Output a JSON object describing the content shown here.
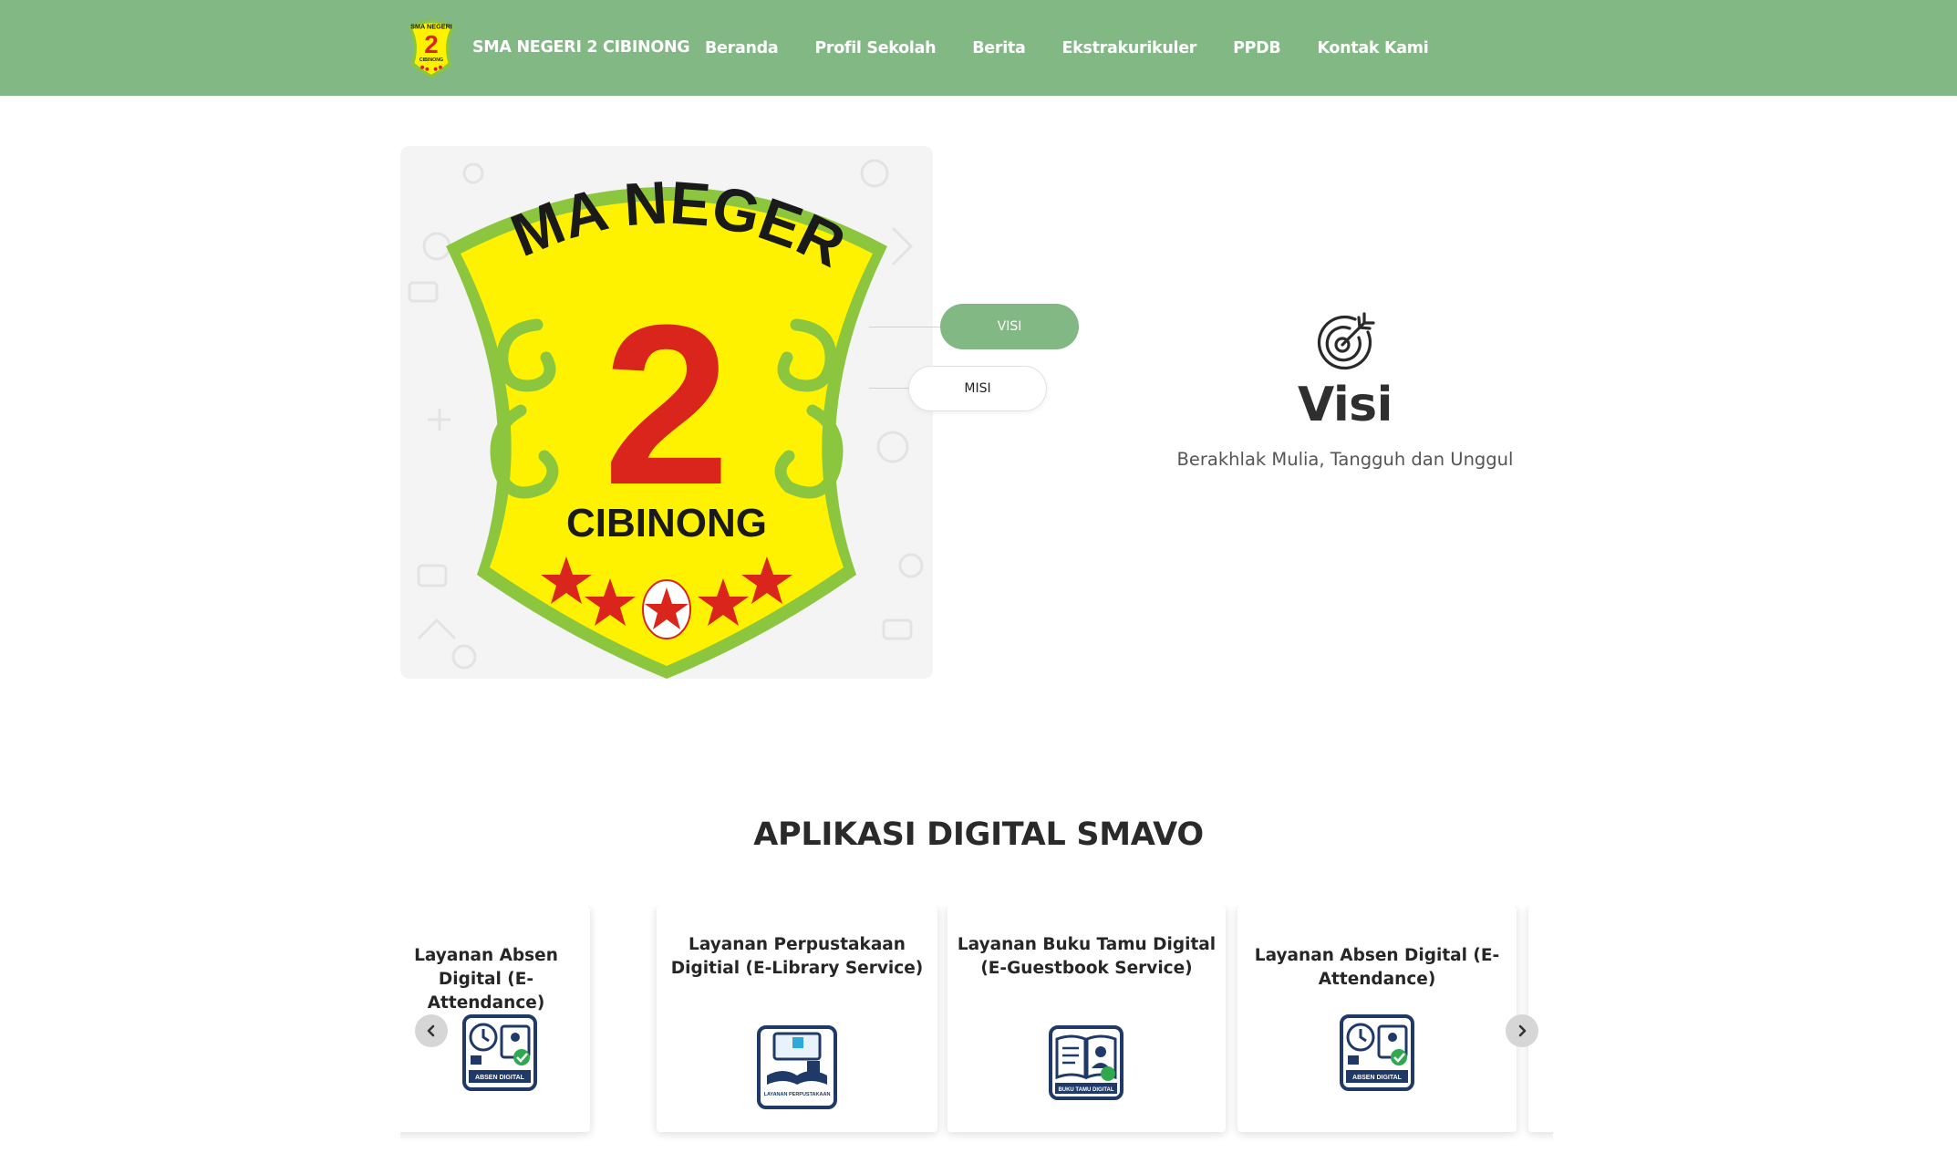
{
  "brand": {
    "name": "SMA NEGERI 2 CIBINONG",
    "logo_lettering": {
      "top": "SMA NEGERI",
      "number": "2",
      "bottom": "CIBINONG"
    }
  },
  "nav": {
    "items": [
      "Beranda",
      "Profil Sekolah",
      "Berita",
      "Ekstrakurikuler",
      "PPDB",
      "Kontak Kami"
    ]
  },
  "hero": {
    "tabs": [
      {
        "label": "VISI",
        "active": true
      },
      {
        "label": "MISI",
        "active": false
      }
    ],
    "visi": {
      "icon": "target-arrow-icon",
      "title": "Visi",
      "text": "Berakhlak Mulia, Tangguh dan Unggul"
    }
  },
  "apps": {
    "title": "APLIKASI DIGITAL SMAVO",
    "cards": [
      {
        "title": "Layanan Absen Digital (E-Attendance)",
        "icon": "absen-digital-icon",
        "icon_caption": "ABSEN DIGITAL SMAN 2 CIBINONG"
      },
      {
        "title": "Layanan Perpustakaan Digitial (E-Library Service)",
        "icon": "library-icon",
        "icon_caption": "LAYANAN PERPUSTAKAAN DIGITAL E-LIBRARY SERVICE SMAN 2 CIBINONG"
      },
      {
        "title": "Layanan Buku Tamu Digital (E-Guestbook Service)",
        "icon": "guestbook-icon",
        "icon_caption": "BUKU TAMU DIGITAL SMAN 2 CIBINONG"
      },
      {
        "title": "Layanan Absen Digital (E-Attendance)",
        "icon": "absen-digital-icon",
        "icon_caption": "ABSEN DIGITAL SMAN 2 CIBINONG"
      }
    ],
    "prev_icon": "chevron-left-icon",
    "next_icon": "chevron-right-icon"
  },
  "colors": {
    "nav_bg": "#82b884",
    "accent": "#82b884",
    "logo_yellow": "#fff200",
    "logo_green": "#8cc63f",
    "logo_red": "#d9251c",
    "icon_navy": "#1f3a68"
  }
}
